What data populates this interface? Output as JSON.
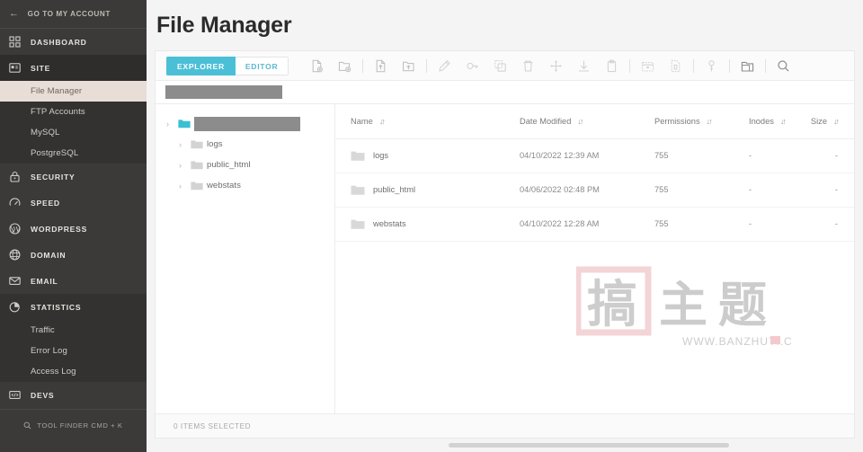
{
  "sidebar": {
    "account": {
      "label": "GO TO MY ACCOUNT",
      "icon": "arrow-left-icon"
    },
    "groups": [
      {
        "label": "DASHBOARD",
        "icon": "dashboard-grid-icon",
        "active": false,
        "open": false,
        "children": []
      },
      {
        "label": "SITE",
        "icon": "site-window-icon",
        "active": true,
        "open": true,
        "children": [
          {
            "label": "File Manager",
            "current": true
          },
          {
            "label": "FTP Accounts",
            "current": false
          },
          {
            "label": "MySQL",
            "current": false
          },
          {
            "label": "PostgreSQL",
            "current": false
          }
        ]
      },
      {
        "label": "SECURITY",
        "icon": "lock-icon",
        "active": false,
        "open": false,
        "children": []
      },
      {
        "label": "SPEED",
        "icon": "speed-gauge-icon",
        "active": false,
        "open": false,
        "children": []
      },
      {
        "label": "WORDPRESS",
        "icon": "wordpress-icon",
        "active": false,
        "open": false,
        "children": []
      },
      {
        "label": "DOMAIN",
        "icon": "globe-icon",
        "active": false,
        "open": false,
        "children": []
      },
      {
        "label": "EMAIL",
        "icon": "envelope-icon",
        "active": false,
        "open": false,
        "children": []
      },
      {
        "label": "STATISTICS",
        "icon": "pie-chart-icon",
        "active": false,
        "open": true,
        "children": [
          {
            "label": "Traffic",
            "current": false
          },
          {
            "label": "Error Log",
            "current": false
          },
          {
            "label": "Access Log",
            "current": false
          }
        ]
      },
      {
        "label": "DEVS",
        "icon": "code-brackets-icon",
        "active": false,
        "open": false,
        "children": []
      }
    ],
    "tool_finder": {
      "label": "TOOL FINDER CMD + K",
      "icon": "search-icon"
    }
  },
  "header": {
    "title": "File Manager"
  },
  "toolbar": {
    "tabs": [
      {
        "label": "EXPLORER",
        "active": true
      },
      {
        "label": "EDITOR",
        "active": false
      }
    ],
    "buttons": [
      {
        "name": "new-file-button",
        "icon": "file-plus-icon",
        "state": "norm"
      },
      {
        "name": "new-folder-button",
        "icon": "folder-plus-icon",
        "state": "norm"
      },
      {
        "name": "separator-1",
        "icon": "separator",
        "state": "sep"
      },
      {
        "name": "upload-file-button",
        "icon": "file-upload-icon",
        "state": "norm"
      },
      {
        "name": "upload-folder-button",
        "icon": "folder-upload-icon",
        "state": "norm"
      },
      {
        "name": "separator-2",
        "icon": "separator",
        "state": "sep"
      },
      {
        "name": "rename-button",
        "icon": "pencil-icon",
        "state": "dim"
      },
      {
        "name": "permissions-button",
        "icon": "permissions-icon",
        "state": "dim"
      },
      {
        "name": "copy-button",
        "icon": "copy-icon",
        "state": "dim"
      },
      {
        "name": "delete-button",
        "icon": "trash-icon",
        "state": "dim"
      },
      {
        "name": "move-button",
        "icon": "move-arrows-icon",
        "state": "dim"
      },
      {
        "name": "download-button",
        "icon": "download-icon",
        "state": "dim"
      },
      {
        "name": "paste-button",
        "icon": "paste-icon",
        "state": "dim"
      },
      {
        "name": "separator-3",
        "icon": "separator",
        "state": "sep"
      },
      {
        "name": "archive-button",
        "icon": "archive-box-icon",
        "state": "dim"
      },
      {
        "name": "extract-button",
        "icon": "extract-file-icon",
        "state": "dim"
      },
      {
        "name": "separator-4",
        "icon": "separator",
        "state": "sep"
      },
      {
        "name": "protect-button",
        "icon": "key-icon",
        "state": "dim"
      },
      {
        "name": "separator-5",
        "icon": "separator",
        "state": "sep"
      },
      {
        "name": "change-directory-button",
        "icon": "open-folder-icon",
        "state": "dark"
      },
      {
        "name": "separator-6",
        "icon": "separator",
        "state": "sep"
      },
      {
        "name": "search-button",
        "icon": "search-icon",
        "state": "dark"
      }
    ]
  },
  "breadcrumb": {
    "redacted": true,
    "redacted_width": 130
  },
  "tree": {
    "root": {
      "label": "",
      "redacted": true,
      "redacted_width": 118,
      "expanded": true,
      "caret": "›",
      "icon": "folder-teal-icon"
    },
    "children": [
      {
        "label": "logs",
        "caret": "›",
        "icon": "folder-gray-icon"
      },
      {
        "label": "public_html",
        "caret": "›",
        "icon": "folder-gray-icon"
      },
      {
        "label": "webstats",
        "caret": "›",
        "icon": "folder-gray-icon"
      }
    ]
  },
  "filetable": {
    "columns": [
      {
        "label": "Name",
        "sort_icon": "sort-updown-icon"
      },
      {
        "label": "Date Modified",
        "sort_icon": "sort-updown-icon"
      },
      {
        "label": "Permissions",
        "sort_icon": "sort-updown-icon"
      },
      {
        "label": "Inodes",
        "sort_icon": "sort-updown-icon"
      },
      {
        "label": "Size",
        "sort_icon": "sort-updown-icon"
      }
    ],
    "rows": [
      {
        "name": "logs",
        "date": "04/10/2022 12:39 AM",
        "permissions": "755",
        "inodes": "-",
        "size": "-",
        "icon": "folder-gray-icon"
      },
      {
        "name": "public_html",
        "date": "04/06/2022 02:48 PM",
        "permissions": "755",
        "inodes": "-",
        "size": "-",
        "icon": "folder-gray-icon"
      },
      {
        "name": "webstats",
        "date": "04/10/2022 12:28 AM",
        "permissions": "755",
        "inodes": "-",
        "size": "-",
        "icon": "folder-gray-icon"
      }
    ]
  },
  "watermark": {
    "glyphs": "搬主题",
    "url": "WWW.BANZHUTI.COM"
  },
  "statusbar": {
    "text": "0 ITEMS SELECTED"
  },
  "colors": {
    "accent": "#4bbfd6",
    "sidebar_bg": "#3b3a38",
    "sidebar_active_bg": "#2e2d2b",
    "sidebar_current_bg": "#e8ddd7",
    "page_bg": "#f4f4f4",
    "panel_bg": "#ffffff",
    "folder_teal": "#3bbfd3",
    "redact_gray": "#8c8c8c"
  }
}
